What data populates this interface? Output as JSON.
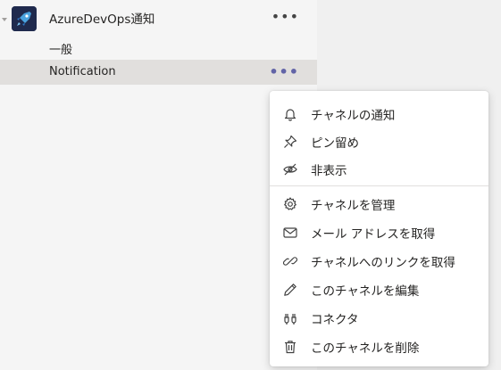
{
  "team": {
    "name": "AzureDevOps通知",
    "more_label": "•••",
    "avatar_color": "#1f2a4d"
  },
  "channels": [
    {
      "label": "一般",
      "selected": false
    },
    {
      "label": "Notification",
      "selected": true,
      "more_label": "•••"
    }
  ],
  "menu": {
    "items": [
      {
        "label": "チャネルの通知",
        "icon": "bell-icon"
      },
      {
        "label": "ピン留め",
        "icon": "pin-icon"
      },
      {
        "label": "非表示",
        "icon": "eye-off-icon"
      },
      {
        "label": "チャネルを管理",
        "icon": "gear-icon"
      },
      {
        "label": "メール アドレスを取得",
        "icon": "mail-icon"
      },
      {
        "label": "チャネルへのリンクを取得",
        "icon": "link-icon"
      },
      {
        "label": "このチャネルを編集",
        "icon": "pencil-icon"
      },
      {
        "label": "コネクタ",
        "icon": "connector-icon"
      },
      {
        "label": "このチャネルを削除",
        "icon": "trash-icon"
      }
    ]
  },
  "colors": {
    "accent": "#6264a7",
    "selected_row": "#e1dfdd",
    "menu_bg": "#ffffff"
  }
}
